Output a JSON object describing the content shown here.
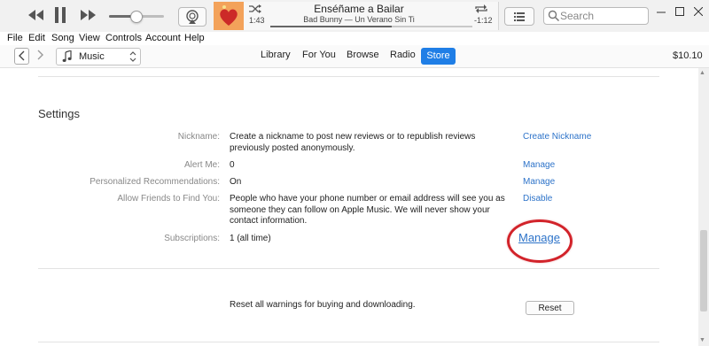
{
  "player": {
    "song_title": "Enséñame a Bailar",
    "song_artist": "Bad Bunny — Un Verano Sin Ti",
    "time_elapsed": "1:43",
    "time_remaining": "-1:12",
    "progress": 0.6,
    "volume": 0.45
  },
  "search": {
    "placeholder": "Search"
  },
  "menu": [
    "File",
    "Edit",
    "Song",
    "View",
    "Controls",
    "Account",
    "Help"
  ],
  "nav": {
    "media_type": "Music",
    "tabs": [
      "Library",
      "For You",
      "Browse",
      "Radio"
    ],
    "active_tab": "Store",
    "balance": "$10.10"
  },
  "settings": {
    "heading": "Settings",
    "rows": [
      {
        "label": "Nickname:",
        "value": "Create a nickname to post new reviews or to republish reviews previously posted anonymously.",
        "action": "Create Nickname"
      },
      {
        "label": "Alert Me:",
        "value": "0",
        "action": "Manage"
      },
      {
        "label": "Personalized Recommendations:",
        "value": "On",
        "action": "Manage"
      },
      {
        "label": "Allow Friends to Find You:",
        "value": "People who have your phone number or email address will see you as someone they can follow on Apple Music. We will never show your contact information.",
        "action": "Disable"
      },
      {
        "label": "Subscriptions:",
        "value": "1 (all time)",
        "action": "Manage"
      }
    ]
  },
  "reset": {
    "text": "Reset all warnings for buying and downloading.",
    "button": "Reset"
  },
  "colors": {
    "accent": "#1f7ee6",
    "link": "#2d73c9",
    "highlight": "#d2232a"
  }
}
